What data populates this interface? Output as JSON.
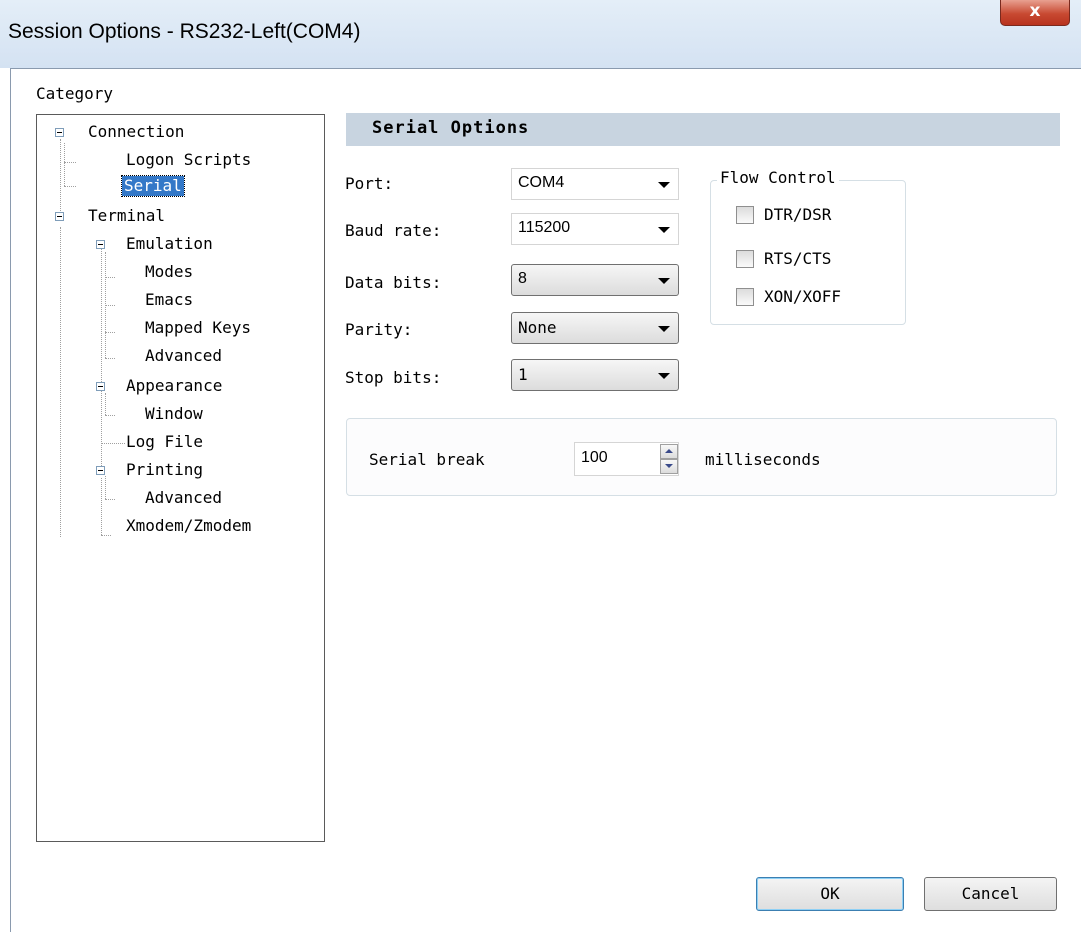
{
  "window": {
    "title": "Session Options - RS232-Left(COM4)",
    "close_glyph": "x"
  },
  "category_label": "Category",
  "tree": {
    "connection": "Connection",
    "logon_scripts": "Logon Scripts",
    "serial": "Serial",
    "terminal": "Terminal",
    "emulation": "Emulation",
    "modes": "Modes",
    "emacs": "Emacs",
    "mapped_keys": "Mapped Keys",
    "advanced_emulation": "Advanced",
    "appearance": "Appearance",
    "window": "Window",
    "log_file": "Log File",
    "printing": "Printing",
    "advanced_printing": "Advanced",
    "xmodem": "Xmodem/Zmodem"
  },
  "section_title": "Serial Options",
  "fields": {
    "port": {
      "label": "Port:",
      "value": "COM4"
    },
    "baud": {
      "label": "Baud rate:",
      "value": "115200"
    },
    "data_bits": {
      "label": "Data bits:",
      "value": "8"
    },
    "parity": {
      "label": "Parity:",
      "value": "None"
    },
    "stop_bits": {
      "label": "Stop bits:",
      "value": "1"
    }
  },
  "flow_control": {
    "title": "Flow Control",
    "dtr_dsr": "DTR/DSR",
    "rts_cts": "RTS/CTS",
    "xon_xoff": "XON/XOFF"
  },
  "serial_break": {
    "label": "Serial break",
    "value": "100",
    "unit": "milliseconds"
  },
  "buttons": {
    "ok": "OK",
    "cancel": "Cancel"
  }
}
